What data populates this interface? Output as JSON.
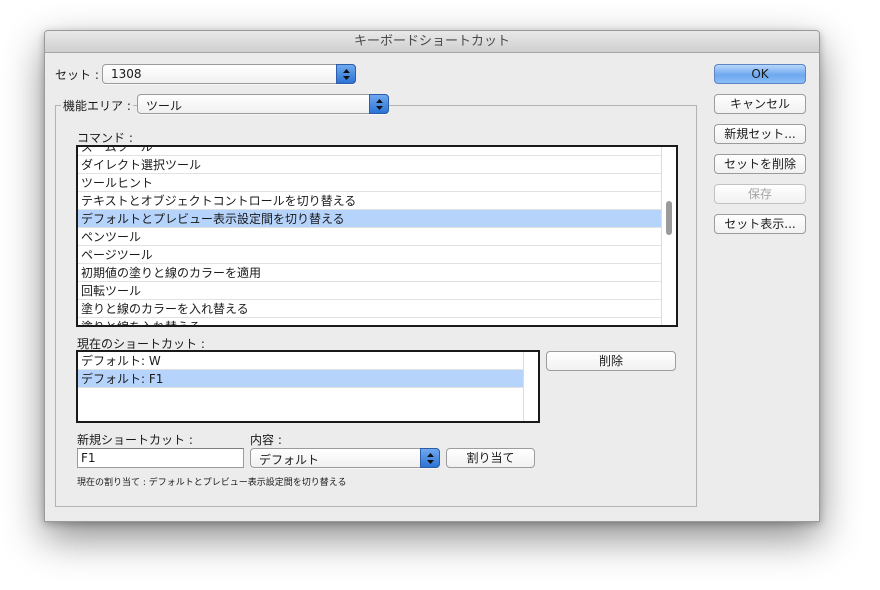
{
  "window": {
    "title": "キーボードショートカット"
  },
  "set": {
    "label": "セット :",
    "value": "1308"
  },
  "feature_area": {
    "label": "機能エリア :",
    "value": "ツール"
  },
  "commands": {
    "label": "コマンド :",
    "items": [
      {
        "label": "ズームツール",
        "selected": false
      },
      {
        "label": "ダイレクト選択ツール",
        "selected": false
      },
      {
        "label": "ツールヒント",
        "selected": false
      },
      {
        "label": "テキストとオブジェクトコントロールを切り替える",
        "selected": false
      },
      {
        "label": "デフォルトとプレビュー表示設定間を切り替える",
        "selected": true
      },
      {
        "label": "ペンツール",
        "selected": false
      },
      {
        "label": "ページツール",
        "selected": false
      },
      {
        "label": "初期値の塗りと線のカラーを適用",
        "selected": false
      },
      {
        "label": "回転ツール",
        "selected": false
      },
      {
        "label": "塗りと線のカラーを入れ替える",
        "selected": false
      },
      {
        "label": "塗りと線を入れ替える",
        "selected": false
      }
    ]
  },
  "current_shortcuts": {
    "label": "現在のショートカット :",
    "items": [
      {
        "label": "デフォルト: W",
        "selected": false
      },
      {
        "label": "デフォルト: F1",
        "selected": true
      }
    ],
    "remove_label": "削除"
  },
  "new_shortcut": {
    "label": "新規ショートカット :",
    "value": "F1"
  },
  "context": {
    "label": "内容 :",
    "value": "デフォルト"
  },
  "assign_label": "割り当て",
  "current_assignment_text": "現在の割り当て : デフォルトとプレビュー表示設定間を切り替える",
  "buttons": {
    "ok": "OK",
    "cancel": "キャンセル",
    "new_set": "新規セット...",
    "delete_set": "セットを削除",
    "save": "保存",
    "show_set": "セット表示..."
  },
  "colors": {
    "accent": "#6ea8ef",
    "selection": "#b6d3fb"
  }
}
